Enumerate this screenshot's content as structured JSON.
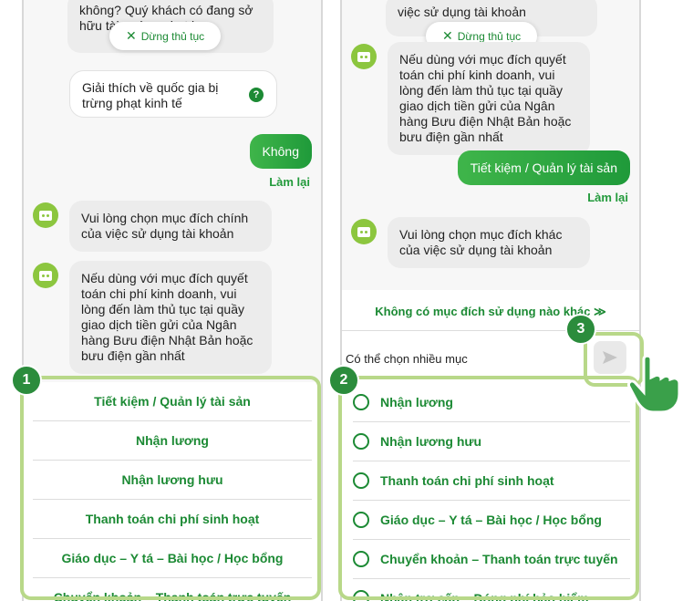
{
  "left": {
    "stop_label": "Dừng thủ tục",
    "partial_top_text": "không? Quý khách có đang sở hữu tài ... ứng phạt k...",
    "explain_card": "Giải thích về quốc gia bị trừng phạt kinh tế",
    "help_icon_text": "?",
    "user_reply": "Không",
    "redo_label": "Làm lại",
    "bot_messages": [
      "Vui lòng chọn mục đích chính của việc sử dụng tài khoản",
      "Nếu dùng với mục đích quyết toán chi phí kinh doanh, vui lòng đến làm thủ tục tại quầy giao dịch tiền gửi của Ngân hàng Bưu điện Nhật Bản hoặc bưu điện gần nhất"
    ],
    "options": [
      "Tiết kiệm / Quản lý tài sản",
      "Nhận lương",
      "Nhận lương hưu",
      "Thanh toán chi phí sinh hoạt",
      "Giáo dục – Y tá – Bài học / Học bổng",
      "Chuyển khoản – Thanh toán trực tuyến"
    ],
    "marker": "1"
  },
  "right": {
    "partial_top_text": "việc sử dụng tài khoản",
    "stop_label": "Dừng thủ tục",
    "bot_messages": [
      "Nếu dùng với mục đích quyết toán chi phí kinh doanh, vui lòng đến làm thủ tục tại quầy giao dịch tiền gửi của Ngân hàng Bưu điện Nhật Bản hoặc bưu điện gần nhất",
      "Vui lòng chọn mục đích khác của việc sử dụng tài khoản"
    ],
    "user_reply": "Tiết kiệm / Quản lý tài sản",
    "redo_label": "Làm lại",
    "none_link": "Không có mục đích sử dụng nào khác ≫",
    "multi_hint": "Có thể chọn nhiều mục",
    "options": [
      "Nhận lương",
      "Nhận lương hưu",
      "Thanh toán chi phí sinh hoạt",
      "Giáo dục – Y tá – Bài học / Học bổng",
      "Chuyển khoản – Thanh toán trực tuyến",
      "Nhận trợ cấp – Đóng phí bảo hiểm"
    ],
    "marker_options": "2",
    "marker_send": "3"
  },
  "colors": {
    "accent": "#1c8a34",
    "highlight": "#b8d889",
    "marker": "#2b8c3c",
    "bot": "#8cc63f"
  }
}
